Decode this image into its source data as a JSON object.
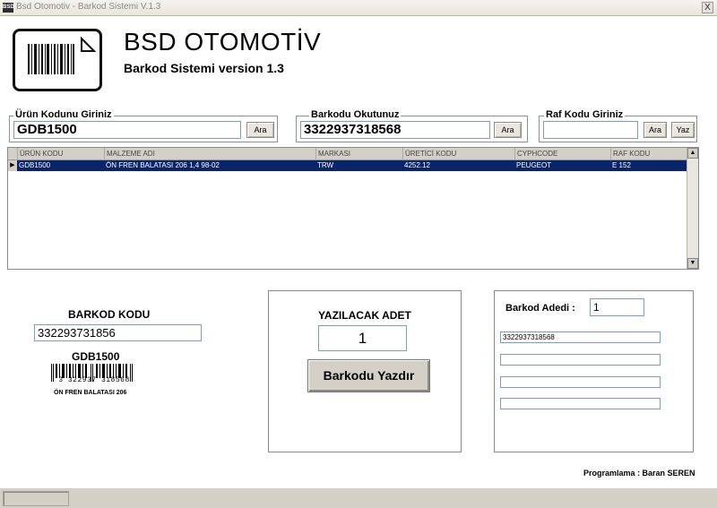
{
  "window": {
    "title": "Bsd Otomotiv - Barkod Sistemi V.1.3",
    "app_icon": "BSD",
    "close_label": "X"
  },
  "header": {
    "brand": "BSD OTOMOTİV",
    "subtitle": "Barkod Sistemi version 1.3",
    "logo_icon": "barcode-logo-icon"
  },
  "product_search": {
    "legend": "Ürün Kodunu Giriniz",
    "value": "GDB1500",
    "button": "Ara"
  },
  "barcode_read": {
    "legend": "Barkodu Okutunuz",
    "value": "3322937318568",
    "button": "Ara"
  },
  "shelf_code": {
    "legend": "Raf Kodu Giriniz",
    "value": "",
    "search_button": "Ara",
    "write_button": "Yaz"
  },
  "grid": {
    "columns": [
      "ÜRÜN KODU",
      "MALZEME ADI",
      "MARKASI",
      "ÜRETİCİ KODU",
      "CYPHCODE",
      "RAF KODU"
    ],
    "rows": [
      [
        "GDB1500",
        "ÖN FREN BALATASI 206 1,4 98-02",
        "TRW",
        "4252.12",
        "PEUGEOT",
        "E 152"
      ]
    ]
  },
  "barcode_panel": {
    "title": "BARKOD KODU",
    "value": "332293731856",
    "product_code": "GDB1500",
    "barcode_digits": "3 322937 318568",
    "product_name": "ÖN FREN BALATASI 206"
  },
  "print_panel": {
    "title": "YAZILACAK ADET",
    "quantity": "1",
    "print_button": "Barkodu Yazdır"
  },
  "count_panel": {
    "label": "Barkod Adedi :",
    "count": "1",
    "lines": [
      "3322937318568",
      "",
      "",
      ""
    ]
  },
  "footer": {
    "credit": "Programlama : Baran SEREN"
  },
  "colors": {
    "selection": "#0a246a",
    "window_bg": "#d4d0c8"
  }
}
